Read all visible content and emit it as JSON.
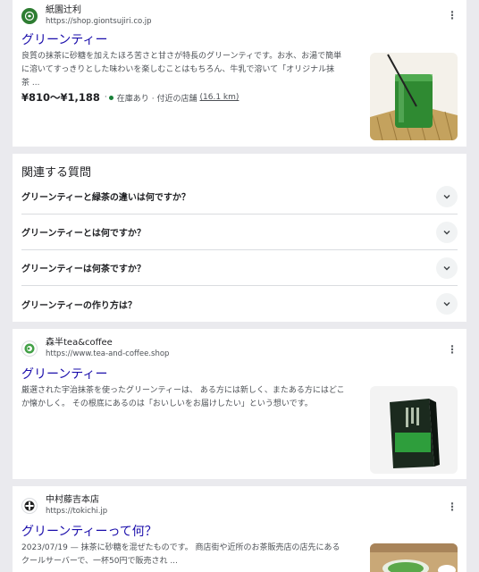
{
  "results": [
    {
      "site_name": "紙園辻利",
      "url": "https://shop.giontsujiri.co.jp",
      "title": "グリーンティー",
      "snippet_lines": [
        "良質の抹茶に砂糖を加えたほろ苦さと甘さが特長のグリーンティです。お水、お湯で簡単",
        "に溶いてすっきりとした味わいを楽しむことはもちろん、牛乳で溶いて「オリジナル抹",
        "茶 ..."
      ],
      "price": "¥810〜¥1,188",
      "stock_status": "在庫あり",
      "nearby_text": "· 付近の店舗",
      "distance": "(16.1 km)",
      "favicon_icon": "green-tea-leaf-icon",
      "thumbnail": "green-tea-glass-image"
    },
    {
      "site_name": "森半tea&coffee",
      "url": "https://www.tea-and-coffee.shop",
      "title": "グリーンティー",
      "snippet_lines": [
        "厳選された宇治抹茶を使ったグリーンティーは、 ある方には新しく、またある方にはどこ",
        "か懐かしく。 その根底にあるのは「おいしいをお届けしたい」という想いです。"
      ],
      "favicon_icon": "morihan-logo-icon",
      "thumbnail": "green-tea-box-image"
    },
    {
      "site_name": "中村藤吉本店",
      "url": "https://tokichi.jp",
      "title": "グリーンティーって何？",
      "snippet_lines": [
        "2023/07/19 — 抹茶に砂糖を混ぜたものです。 商店街や近所のお茶販売店の店先にある",
        "クールサーバーで、一杯50円で販売され ..."
      ],
      "favicon_icon": "tokichi-crest-icon",
      "thumbnail": "green-tea-bowl-image"
    }
  ],
  "related_questions": {
    "heading": "関連する質問",
    "items": [
      "グリーンティーと緑茶の違いは何ですか？",
      "グリーンティーとは何ですか？",
      "グリーンティーは何茶ですか？",
      "グリーンティーの作り方は？"
    ]
  },
  "colors": {
    "link": "#1a0dab",
    "background": "#eaeaee",
    "stock_green": "#188038"
  }
}
